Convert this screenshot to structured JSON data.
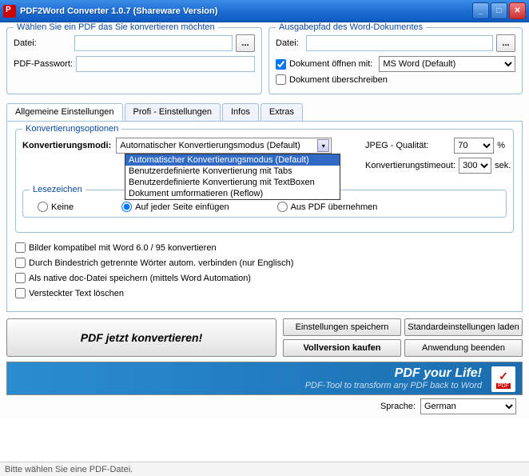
{
  "title": "PDF2Word Converter 1.0.7 (Shareware Version)",
  "group_select": {
    "legend": "Wählen Sie ein PDF das Sie konvertieren möchten",
    "file_label": "Datei:",
    "pwd_label": "PDF-Passwort:"
  },
  "group_output": {
    "legend": "Ausgabepfad des Word-Dokumentes",
    "file_label": "Datei:",
    "open_with": "Dokument öffnen mit:",
    "open_with_val": "MS Word (Default)",
    "overwrite": "Dokument überschreiben"
  },
  "tabs": [
    "Allgemeine Einstellungen",
    "Profi - Einstellungen",
    "Infos",
    "Extras"
  ],
  "conv": {
    "legend": "Konvertierungsoptionen",
    "mode_label": "Konvertierungsmodi:",
    "mode_val": "Automatischer Konvertierungsmodus (Default)",
    "dropdown": [
      "Automatischer Konvertierungsmodus (Default)",
      "Benutzerdefinierte Konvertierung mit Tabs",
      "Benutzerdefinierte Konvertierung mit TextBoxen",
      "Dokument umformatieren (Reflow)"
    ],
    "jpeg_label": "JPEG - Qualität:",
    "jpeg_val": "70",
    "jpeg_unit": "%",
    "timeout_label": "Konvertierungstimeout:",
    "timeout_val": "300",
    "timeout_unit": "sek."
  },
  "bookmarks": {
    "legend": "Lesezeichen",
    "none": "Keine",
    "each_page": "Auf jeder Seite einfügen",
    "from_pdf": "Aus PDF übernehmen"
  },
  "checks": {
    "c1": "Bilder kompatibel mit Word 6.0 / 95 konvertieren",
    "c2": "Durch Bindestrich getrennte Wörter autom. verbinden (nur Englisch)",
    "c3": "Als native doc-Datei speichern (mittels Word Automation)",
    "c4": "Versteckter Text löschen"
  },
  "buttons": {
    "convert": "PDF jetzt konvertieren!",
    "save_settings": "Einstellungen speichern",
    "load_defaults": "Standardeinstellungen laden",
    "buy_full": "Vollversion kaufen",
    "quit": "Anwendung beenden"
  },
  "banner": {
    "line1": "PDF your Life!",
    "line2": "PDF-Tool to transform any PDF back to Word"
  },
  "lang_label": "Sprache:",
  "lang_val": "German",
  "status": "Bitte wählen Sie eine PDF-Datei."
}
